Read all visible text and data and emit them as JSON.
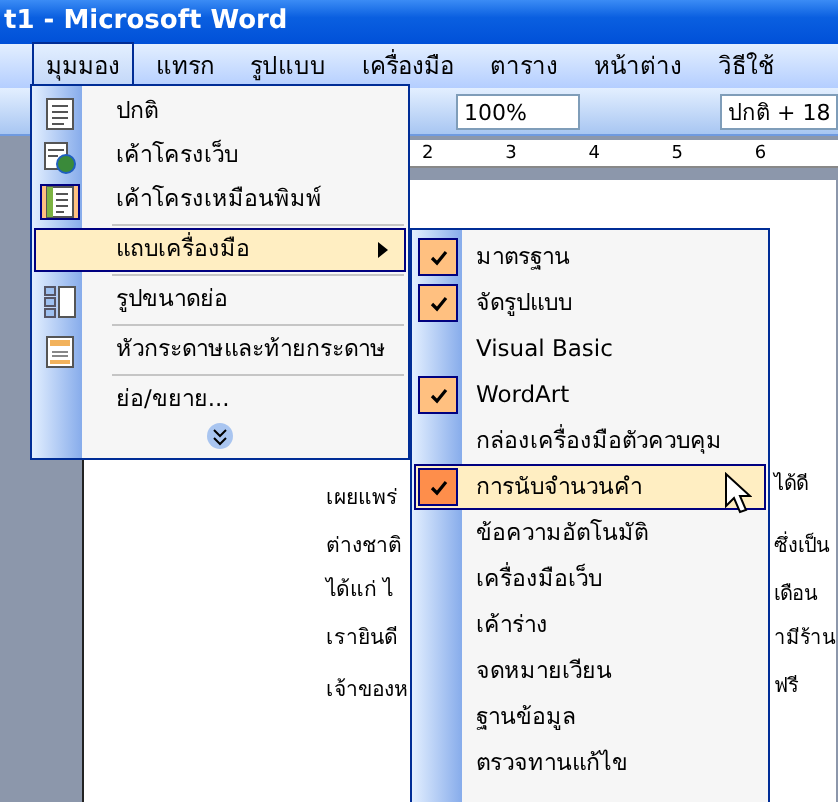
{
  "window": {
    "title": "t1 - Microsoft Word"
  },
  "menu_bar": [
    {
      "label": "มุมมอง",
      "selected": true
    },
    {
      "label": "แทรก",
      "selected": false
    },
    {
      "label": "รูปแบบ",
      "selected": false
    },
    {
      "label": "เครื่องมือ",
      "selected": false
    },
    {
      "label": "ตาราง",
      "selected": false
    },
    {
      "label": "หน้าต่าง",
      "selected": false
    },
    {
      "label": "วิธีใช้",
      "selected": false
    }
  ],
  "toolbar": {
    "zoom": "100%",
    "style": "ปกติ + 18"
  },
  "ruler": {
    "ticks": [
      "2",
      "3",
      "4",
      "5",
      "6"
    ]
  },
  "document": {
    "left_lines": [
      "เผยแพร่",
      "ต่างชาติ",
      "ได้แก่ ไ",
      "เรายินดี",
      "เจ้าของห"
    ],
    "right_lines": [
      "ได้ดี",
      "ซึ่งเป็น",
      "เดือน",
      "ามีร้าน",
      "ฟรี"
    ]
  },
  "view_menu": {
    "items": [
      {
        "kind": "item",
        "label": "ปกติ",
        "checked": false,
        "selected": false
      },
      {
        "kind": "item",
        "label": "เค้าโครงเว็บ",
        "checked": false,
        "selected": false
      },
      {
        "kind": "item",
        "label": "เค้าโครงเหมือนพิมพ์",
        "checked": true,
        "selected": false
      },
      {
        "kind": "separator"
      },
      {
        "kind": "submenu",
        "label": "แถบเครื่องมือ",
        "selected": true
      },
      {
        "kind": "separator"
      },
      {
        "kind": "item",
        "label": "รูปขนาดย่อ",
        "checked": false,
        "selected": false
      },
      {
        "kind": "separator"
      },
      {
        "kind": "item",
        "label": "หัวกระดาษและท้ายกระดาษ",
        "checked": false,
        "selected": false
      },
      {
        "kind": "separator"
      },
      {
        "kind": "item",
        "label": "ย่อ/ขยาย...",
        "checked": false,
        "selected": false
      }
    ]
  },
  "toolbars_menu": {
    "items": [
      {
        "label": "มาตรฐาน",
        "checked": true,
        "selected": false
      },
      {
        "label": "จัดรูปแบบ",
        "checked": true,
        "selected": false
      },
      {
        "label": "Visual Basic",
        "checked": false,
        "selected": false
      },
      {
        "label": "WordArt",
        "checked": true,
        "selected": false
      },
      {
        "label": "กล่องเครื่องมือตัวควบคุม",
        "checked": false,
        "selected": false
      },
      {
        "label": "การนับจำนวนคำ",
        "checked": true,
        "selected": true
      },
      {
        "label": "ข้อความอัตโนมัติ",
        "checked": false,
        "selected": false
      },
      {
        "label": "เครื่องมือเว็บ",
        "checked": false,
        "selected": false
      },
      {
        "label": "เค้าร่าง",
        "checked": false,
        "selected": false
      },
      {
        "label": "จดหมายเวียน",
        "checked": false,
        "selected": false
      },
      {
        "label": "ฐานข้อมูล",
        "checked": false,
        "selected": false
      },
      {
        "label": "ตรวจทานแก้ไข",
        "checked": false,
        "selected": false
      }
    ]
  }
}
